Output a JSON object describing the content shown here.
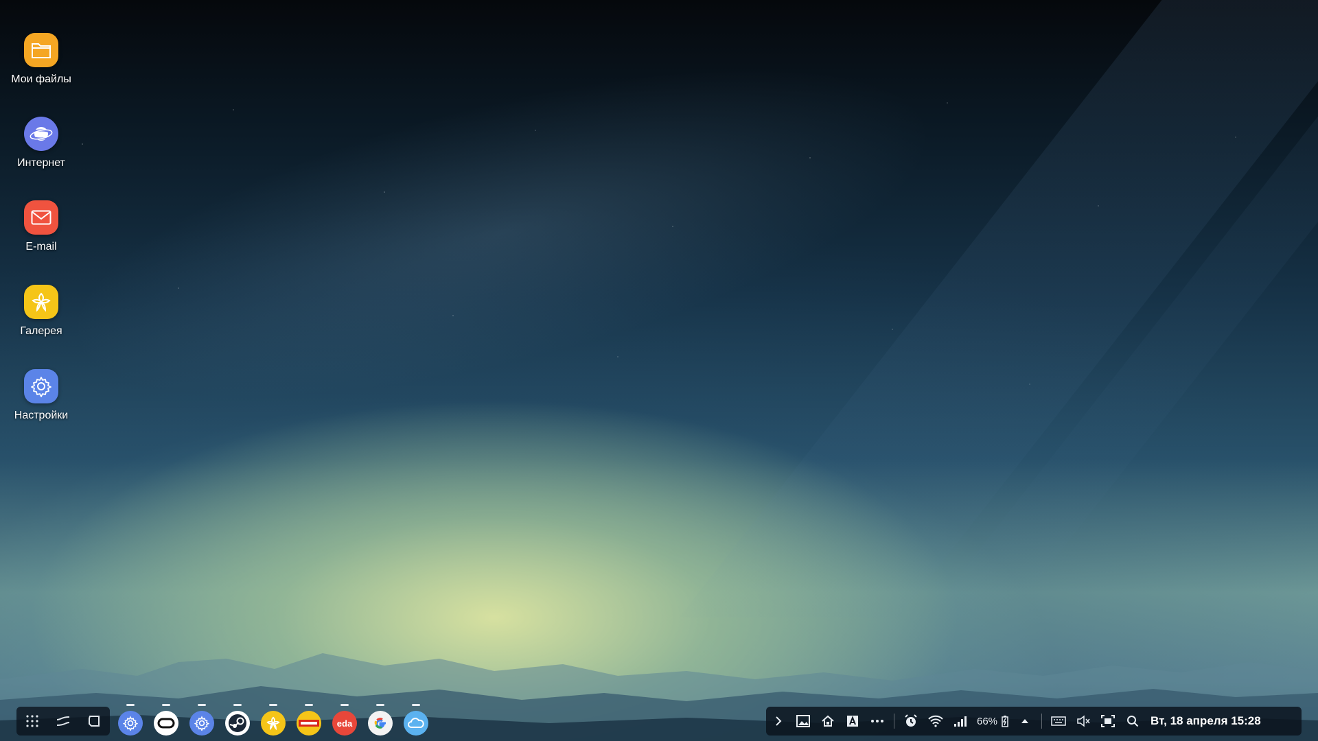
{
  "desktop": {
    "icons": [
      {
        "label": "Мои файлы",
        "icon": "folder-icon",
        "color": "#F5A623"
      },
      {
        "label": "Интернет",
        "icon": "internet-icon",
        "color": "#6A79E8"
      },
      {
        "label": "E-mail",
        "icon": "email-icon",
        "color": "#F0533F"
      },
      {
        "label": "Галерея",
        "icon": "gallery-icon",
        "color": "#F5C518"
      },
      {
        "label": "Настройки",
        "icon": "settings-icon",
        "color": "#5B84E8"
      }
    ]
  },
  "taskbar": {
    "nav_buttons": [
      "apps-icon",
      "recents-icon",
      "back-icon"
    ],
    "pinned_apps": [
      {
        "name": "settings",
        "color": "#5B84E8"
      },
      {
        "name": "oculus",
        "color": "#FFFFFF"
      },
      {
        "name": "settings-2",
        "color": "#5B84E8"
      },
      {
        "name": "steam",
        "color": "#FFFFFF"
      },
      {
        "name": "gallery",
        "color": "#F5C518"
      },
      {
        "name": "app-yellow",
        "color": "#F5C518"
      },
      {
        "name": "eda",
        "color": "#E8473A",
        "text": "eda"
      },
      {
        "name": "google",
        "color": "#F3F3F3"
      },
      {
        "name": "weather",
        "color": "#5BB2F0"
      }
    ]
  },
  "tray": {
    "battery_percent": "66%",
    "clock": "Вт, 18 апреля 15:28"
  }
}
